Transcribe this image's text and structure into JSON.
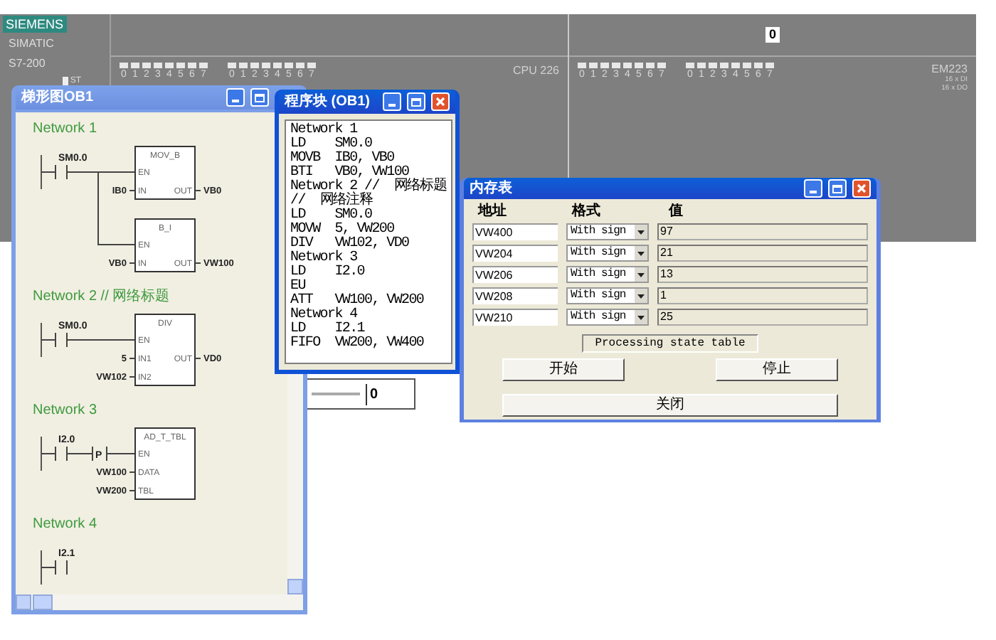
{
  "plc": {
    "brand": "SIEMENS",
    "family": "SIMATIC",
    "model": "S7-200",
    "status_label": "ST",
    "cpu": {
      "label": "CPU 226",
      "led_groups": [
        {
          "digits": [
            "0",
            "1",
            "2",
            "3",
            "4",
            "5",
            "6",
            "7"
          ]
        },
        {
          "digits": [
            "0",
            "1",
            "2",
            "3",
            "4",
            "5",
            "6",
            "7"
          ]
        }
      ]
    },
    "expansion": {
      "display": "0",
      "label": "EM223",
      "specs": [
        "16 x DI",
        "16 x DO"
      ],
      "led_groups": [
        {
          "digits": [
            "0",
            "1",
            "2",
            "3",
            "4",
            "5",
            "6",
            "7"
          ]
        },
        {
          "digits": [
            "0",
            "1",
            "2",
            "3",
            "4",
            "5",
            "6",
            "7"
          ]
        }
      ]
    }
  },
  "ladder_window": {
    "title": "梯形图OB1",
    "networks": [
      {
        "title": "Network 1",
        "contact": "SM0.0",
        "boxes": [
          {
            "name": "MOV_B",
            "en": "EN",
            "inputs": [
              {
                "pin": "IN",
                "operand": "IB0"
              }
            ],
            "outputs": [
              {
                "pin": "OUT",
                "operand": "VB0"
              }
            ]
          },
          {
            "name": "B_I",
            "en": "EN",
            "inputs": [
              {
                "pin": "IN",
                "operand": "VB0"
              }
            ],
            "outputs": [
              {
                "pin": "OUT",
                "operand": "VW100"
              }
            ]
          }
        ]
      },
      {
        "title": "Network 2 // 网络标题",
        "contact": "SM0.0",
        "boxes": [
          {
            "name": "DIV",
            "en": "EN",
            "inputs": [
              {
                "pin": "IN1",
                "operand": "5"
              },
              {
                "pin": "IN2",
                "operand": "VW102"
              }
            ],
            "outputs": [
              {
                "pin": "OUT",
                "operand": "VD0"
              }
            ]
          }
        ]
      },
      {
        "title": "Network 3",
        "contact": "I2.0",
        "edge": "P",
        "boxes": [
          {
            "name": "AD_T_TBL",
            "en": "EN",
            "inputs": [
              {
                "pin": "DATA",
                "operand": "VW100"
              },
              {
                "pin": "TBL",
                "operand": "VW200"
              }
            ]
          }
        ]
      },
      {
        "title": "Network 4",
        "contact": "I2.1"
      }
    ]
  },
  "program_window": {
    "title": "程序块 (OB1)",
    "lines": [
      "Network 1",
      "LD    SM0.0",
      "MOVB  IB0, VB0",
      "BTI   VB0, VW100",
      "Network 2 //  网络标题",
      "//  网络注释",
      "LD    SM0.0",
      "MOVW  5, VW200",
      "DIV   VW102, VD0",
      "Network 3",
      "LD    I2.0",
      "EU",
      "ATT   VW100, VW200",
      "Network 4",
      "LD    I2.1",
      "FIFO  VW200, VW400"
    ]
  },
  "value_field": {
    "value": "0"
  },
  "memory_table": {
    "title": "内存表",
    "columns": [
      "地址",
      "格式",
      "值"
    ],
    "rows": [
      {
        "address": "VW400",
        "format": "With sign",
        "value": "97"
      },
      {
        "address": "VW204",
        "format": "With sign",
        "value": "21"
      },
      {
        "address": "VW206",
        "format": "With sign",
        "value": "13"
      },
      {
        "address": "VW208",
        "format": "With sign",
        "value": "1"
      },
      {
        "address": "VW210",
        "format": "With sign",
        "value": "25"
      }
    ],
    "status": "Processing state table",
    "buttons": [
      "开始",
      "停止",
      "关闭"
    ]
  }
}
